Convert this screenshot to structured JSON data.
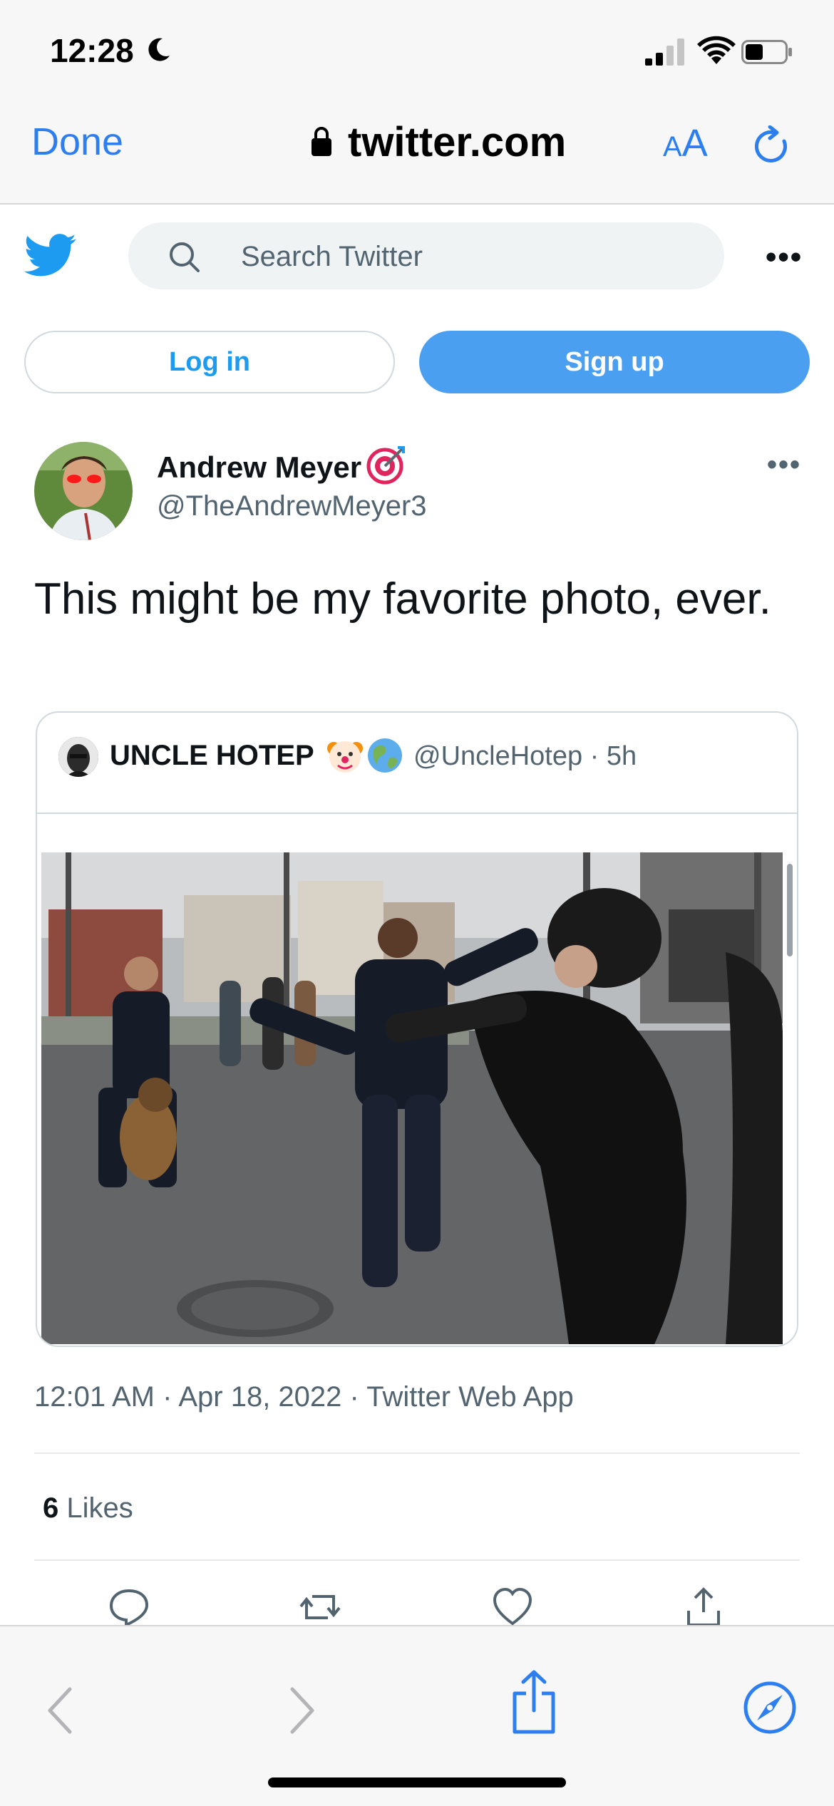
{
  "status_bar": {
    "time": "12:28"
  },
  "browser": {
    "done_label": "Done",
    "url": "twitter.com",
    "text_size_small": "A",
    "text_size_big": "A"
  },
  "twitter_header": {
    "search_placeholder": "Search Twitter",
    "more_label": "•••",
    "login_label": "Log in",
    "signup_label": "Sign up"
  },
  "tweet": {
    "author_name": "Andrew Meyer",
    "author_handle": "@TheAndrewMeyer3",
    "more_label": "•••",
    "text": "This might be my favorite photo, ever.",
    "timestamp": "12:01 AM · Apr 18, 2022 · Twitter Web App",
    "likes_count": "6",
    "likes_label": "Likes"
  },
  "quoted_tweet": {
    "author_name": "UNCLE HOTEP",
    "handle_time": "@UncleHotep · 5h"
  },
  "colors": {
    "safari_blue": "#2d7ff0",
    "twitter_blue": "#1d9bf0",
    "signup_blue": "#4a9ff0",
    "secondary_text": "#536471"
  }
}
